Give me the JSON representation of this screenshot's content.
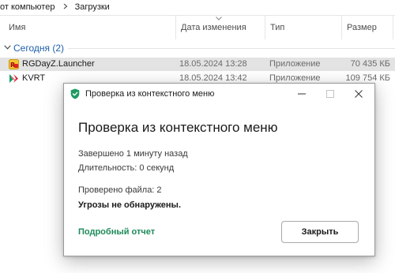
{
  "explorer": {
    "breadcrumb": [
      "от компьютер",
      "Загрузки"
    ],
    "columns": {
      "name": "Имя",
      "date": "Дата изменения",
      "type": "Тип",
      "size": "Размер"
    },
    "group": "Сегодня (2)",
    "rows": [
      {
        "name": "RGDayZ.Launcher",
        "date": "18.05.2024 13:28",
        "type": "Приложение",
        "size": "70 435 КБ",
        "selected": true
      },
      {
        "name": "KVRT",
        "date": "18.05.2024 13:42",
        "type": "Приложение",
        "size": "109 754 КБ",
        "selected": false
      }
    ]
  },
  "dialog": {
    "window_title": "Проверка из контекстного меню",
    "heading": "Проверка из контекстного меню",
    "completed": "Завершено 1 минуту назад",
    "duration": "Длительность: 0 секунд",
    "files_checked": "Проверено файла: 2",
    "result": "Угрозы не обнаружены.",
    "details_link": "Подробный отчет",
    "close_button": "Закрыть"
  },
  "colors": {
    "accent_green": "#1e8a5b",
    "group_blue": "#1f5fa8",
    "selected_row": "#e3e3e3"
  },
  "icons": [
    "chevron-right-icon",
    "sort-caret-icon",
    "chevron-down-icon",
    "launcher-app-icon",
    "kvrt-app-icon",
    "kaspersky-shield-icon",
    "minimize-icon",
    "maximize-icon",
    "close-icon"
  ]
}
